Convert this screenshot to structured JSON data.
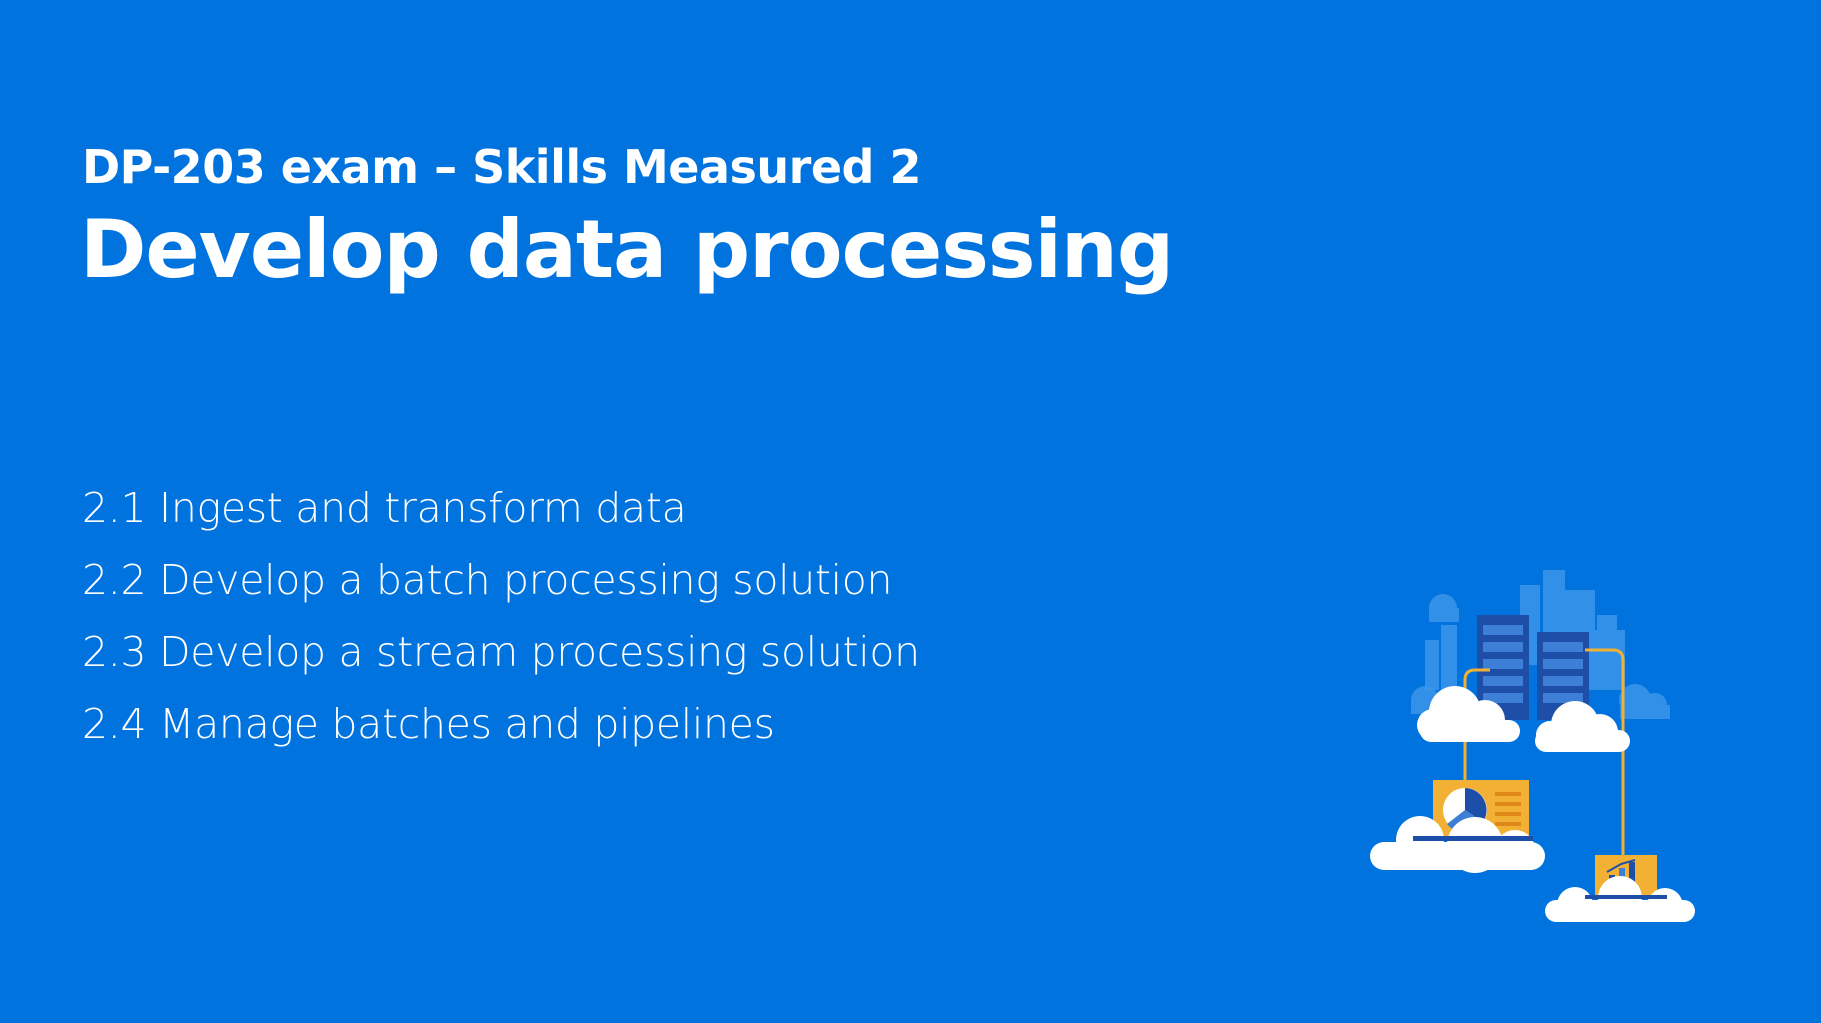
{
  "slide": {
    "subtitle": "DP-203 exam – Skills Measured 2",
    "title": "Develop data processing",
    "skills": [
      "2.1 Ingest and transform data",
      "2.2 Develop a batch processing solution",
      "2.3 Develop a stream processing solution",
      "2.4 Manage batches and pipelines"
    ]
  },
  "colors": {
    "background": "#0073DE",
    "text": "#FFFFFF",
    "accent": "#F2B134"
  },
  "icons": {
    "illustration": "cloud-data-center-illustration"
  }
}
